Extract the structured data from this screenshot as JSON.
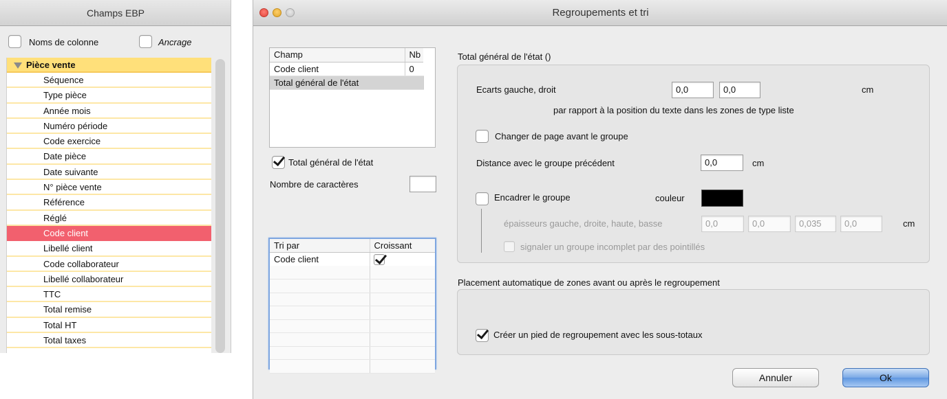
{
  "left_panel": {
    "title": "Champs EBP",
    "noms_colonne": "Noms de colonne",
    "ancrage": "Ancrage",
    "group_label": "Pièce vente",
    "items": [
      "Séquence",
      "Type pièce",
      "Année mois",
      "Numéro période",
      "Code exercice",
      "Date pièce",
      "Date suivante",
      "N° pièce vente",
      "Référence",
      "Réglé",
      "Code client",
      "Libellé client",
      "Code collaborateur",
      "Libellé collaborateur",
      "TTC",
      "Total remise",
      "Total HT",
      "Total taxes"
    ],
    "selected_item": "Code client"
  },
  "dialog": {
    "title": "Regroupements et tri",
    "champ_table": {
      "headers": [
        "Champ",
        "Nb"
      ],
      "rows": [
        [
          "Code client",
          "0"
        ],
        [
          "Total général de l'état",
          ""
        ]
      ]
    },
    "total_general_checkbox": "Total général de l'état",
    "nombre_caracteres_label": "Nombre de caractères",
    "nombre_caracteres_value": "",
    "tri_table": {
      "headers": [
        "Tri par",
        "Croissant"
      ],
      "rows": [
        {
          "field": "Code client",
          "croissant": true
        }
      ]
    },
    "group_section_title": "Total général de l'état ()",
    "ecarts_label": "Ecarts gauche, droit",
    "ecart_gauche": "0,0",
    "ecart_droit": "0,0",
    "unit_cm": "cm",
    "par_rapport_text": "par rapport à la position du texte dans les zones de type liste",
    "changer_page_label": "Changer de page avant le groupe",
    "distance_label": "Distance avec le groupe précédent",
    "distance_value": "0,0",
    "encadrer_label": "Encadrer le groupe",
    "couleur_label": "couleur",
    "couleur_value": "#000000",
    "epaisseurs_label": "épaisseurs gauche, droite, haute, basse",
    "epaisseurs": [
      "0,0",
      "0,0",
      "0,035",
      "0,0"
    ],
    "signaler_label": "signaler un groupe incomplet par des pointillés",
    "placement_title": "Placement automatique de zones avant ou après le regroupement",
    "creer_pied_label": "Créer un pied de regroupement avec les sous-totaux",
    "annuler_label": "Annuler",
    "ok_label": "Ok"
  }
}
